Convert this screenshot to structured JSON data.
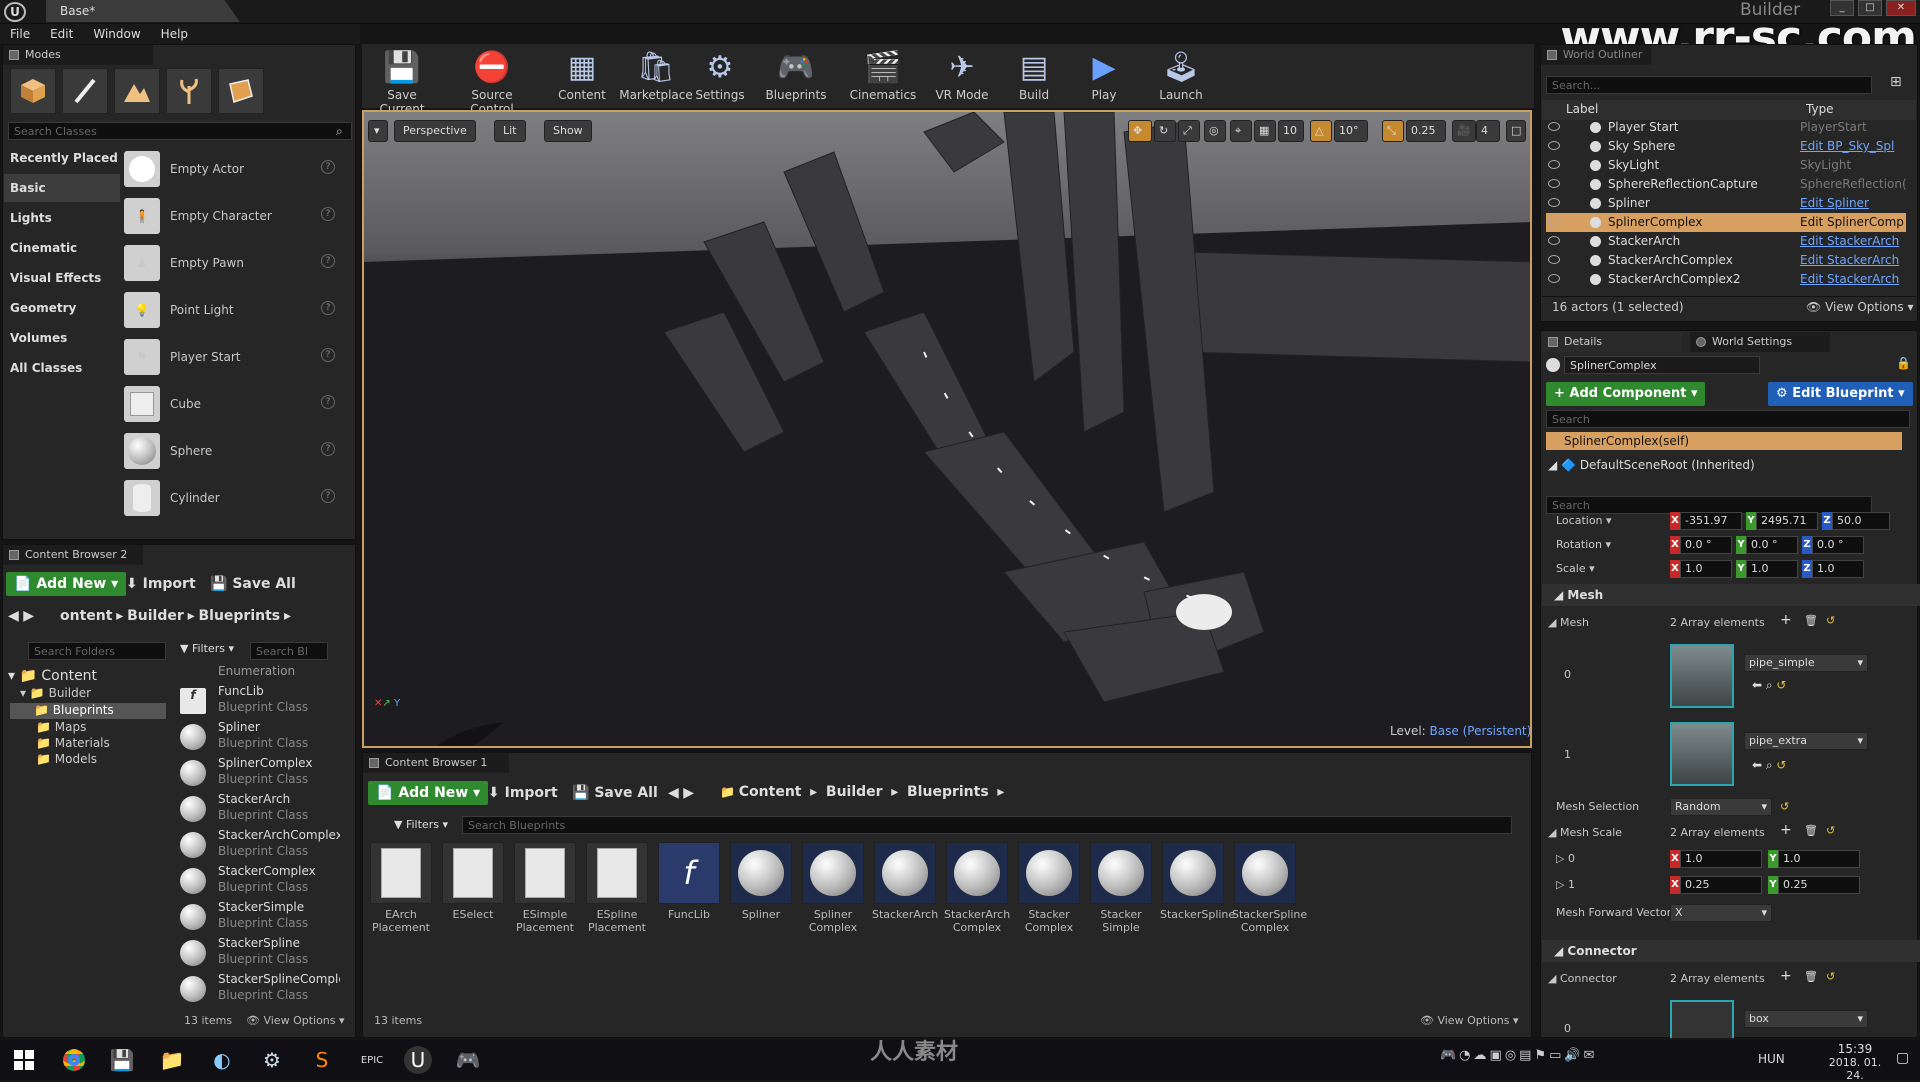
{
  "window": {
    "tab": "Base*",
    "project": "Builder",
    "watermark": "www.rr-sc.com",
    "bottom_watermark": "人人素材"
  },
  "menu": [
    "File",
    "Edit",
    "Window",
    "Help"
  ],
  "modes": {
    "tab": "Modes",
    "search_placeholder": "Search Classes",
    "categories": [
      "Recently Placed",
      "Basic",
      "Lights",
      "Cinematic",
      "Visual Effects",
      "Geometry",
      "Volumes",
      "All Classes"
    ],
    "selected_category": "Basic",
    "items": [
      "Empty Actor",
      "Empty Character",
      "Empty Pawn",
      "Point Light",
      "Player Start",
      "Cube",
      "Sphere",
      "Cylinder"
    ]
  },
  "toolbar": [
    "Save Current",
    "Source Control",
    "Content",
    "Marketplace",
    "Settings",
    "Blueprints",
    "Cinematics",
    "VR Mode",
    "Build",
    "Play",
    "Launch"
  ],
  "viewport": {
    "perspective": "Perspective",
    "lit": "Lit",
    "show": "Show",
    "grid": "10",
    "rotation": "10°",
    "scale": "0.25",
    "camera_speed": "4",
    "level_label": "Level:",
    "level_name": "Base (Persistent)"
  },
  "content_browser_2": {
    "tab": "Content Browser 2",
    "add_new": "Add New",
    "import": "Import",
    "save_all": "Save All",
    "breadcrumb": [
      "ontent",
      "Builder",
      "Blueprints"
    ],
    "search_folders": "Search Folders",
    "filters": "Filters",
    "search": "Search Bl",
    "tree": [
      "Content",
      "Builder",
      "Blueprints",
      "Maps",
      "Materials",
      "Models"
    ],
    "items": [
      {
        "name": "Enumeration",
        "type": ""
      },
      {
        "name": "FuncLib",
        "type": "Blueprint Class"
      },
      {
        "name": "Spliner",
        "type": "Blueprint Class"
      },
      {
        "name": "SplinerComplex",
        "type": "Blueprint Class"
      },
      {
        "name": "StackerArch",
        "type": "Blueprint Class"
      },
      {
        "name": "StackerArchComplex",
        "type": "Blueprint Class"
      },
      {
        "name": "StackerComplex",
        "type": "Blueprint Class"
      },
      {
        "name": "StackerSimple",
        "type": "Blueprint Class"
      },
      {
        "name": "StackerSpline",
        "type": "Blueprint Class"
      },
      {
        "name": "StackerSplineComple:",
        "type": "Blueprint Class"
      }
    ],
    "count": "13 items",
    "view_options": "View Options"
  },
  "content_browser_1": {
    "tab": "Content Browser 1",
    "add_new": "Add New",
    "import": "Import",
    "save_all": "Save All",
    "breadcrumb": [
      "Content",
      "Builder",
      "Blueprints"
    ],
    "filters": "Filters",
    "search_placeholder": "Search Blueprints",
    "assets": [
      {
        "name": "EArch Placement",
        "kind": "doc"
      },
      {
        "name": "ESelect",
        "kind": "doc"
      },
      {
        "name": "ESimple Placement",
        "kind": "doc"
      },
      {
        "name": "ESpline Placement",
        "kind": "doc"
      },
      {
        "name": "FuncLib",
        "kind": "func"
      },
      {
        "name": "Spliner",
        "kind": "ball"
      },
      {
        "name": "Spliner Complex",
        "kind": "ball"
      },
      {
        "name": "StackerArch",
        "kind": "ball"
      },
      {
        "name": "StackerArch Complex",
        "kind": "ball"
      },
      {
        "name": "Stacker Complex",
        "kind": "ball"
      },
      {
        "name": "Stacker Simple",
        "kind": "ball"
      },
      {
        "name": "StackerSpline",
        "kind": "ball"
      },
      {
        "name": "StackerSpline Complex",
        "kind": "ball"
      }
    ],
    "count": "13 items",
    "view_options": "View Options"
  },
  "outliner": {
    "tab": "World Outliner",
    "search": "Search...",
    "col_label": "Label",
    "col_type": "Type",
    "rows": [
      {
        "label": "Player Start",
        "type": "PlayerStart",
        "link": false
      },
      {
        "label": "Sky Sphere",
        "type": "Edit BP_Sky_Spl",
        "link": true
      },
      {
        "label": "SkyLight",
        "type": "SkyLight",
        "link": false
      },
      {
        "label": "SphereReflectionCapture",
        "type": "SphereReflection(",
        "link": false
      },
      {
        "label": "Spliner",
        "type": "Edit Spliner",
        "link": true
      },
      {
        "label": "SplinerComplex",
        "type": "Edit SplinerComp",
        "link": true
      },
      {
        "label": "StackerArch",
        "type": "Edit StackerArch",
        "link": true
      },
      {
        "label": "StackerArchComplex",
        "type": "Edit StackerArch",
        "link": true
      },
      {
        "label": "StackerArchComplex2",
        "type": "Edit StackerArch",
        "link": true
      }
    ],
    "selected": 5,
    "status": "16 actors (1 selected)",
    "view_options": "View Options"
  },
  "details": {
    "tab": "Details",
    "tab2": "World Settings",
    "name": "SplinerComplex",
    "add_component": "Add Component",
    "edit_blueprint": "Edit Blueprint",
    "search": "Search",
    "self": "SplinerComplex(self)",
    "root": "DefaultSceneRoot (Inherited)",
    "location_label": "Location",
    "location": [
      "-351.97",
      "2495.71",
      "50.0"
    ],
    "rotation_label": "Rotation",
    "rotation": [
      "0.0 °",
      "0.0 °",
      "0.0 °"
    ],
    "scale_label": "Scale",
    "scale": [
      "1.0",
      "1.0",
      "1.0"
    ],
    "mesh_section": "Mesh",
    "mesh_label": "Mesh",
    "mesh_count": "2 Array elements",
    "mesh_items": [
      {
        "index": "0",
        "value": "pipe_simple"
      },
      {
        "index": "1",
        "value": "pipe_extra"
      }
    ],
    "mesh_selection_label": "Mesh Selection",
    "mesh_selection": "Random",
    "mesh_scale_label": "Mesh Scale",
    "mesh_scale_count": "2 Array elements",
    "mesh_scale": [
      {
        "index": "0",
        "x": "1.0",
        "y": "1.0"
      },
      {
        "index": "1",
        "x": "0.25",
        "y": "0.25"
      }
    ],
    "forward_label": "Mesh Forward Vector",
    "forward": "X",
    "connector_section": "Connector",
    "connector_label": "Connector",
    "connector_count": "2 Array elements",
    "connector_item": {
      "index": "0",
      "value": "box"
    }
  },
  "taskbar": {
    "lang": "HUN",
    "time": "15:39",
    "date": "2018. 01. 24."
  }
}
